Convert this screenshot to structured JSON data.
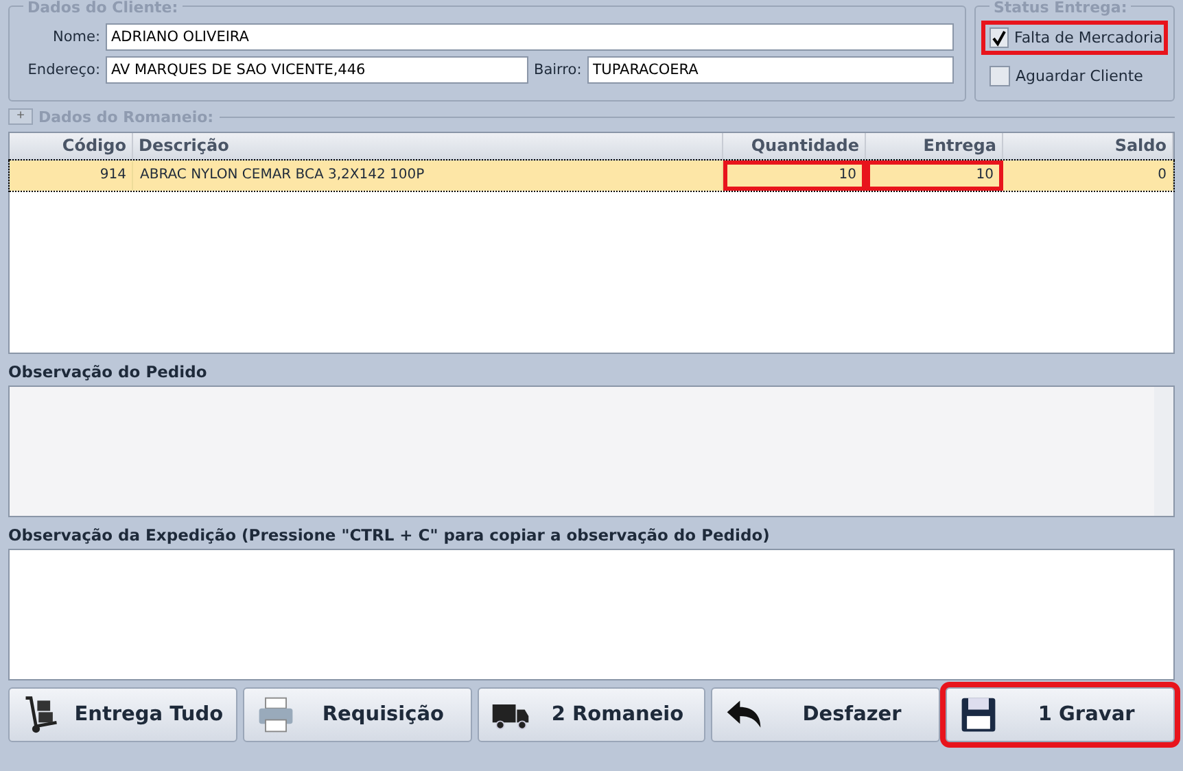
{
  "cliente": {
    "title": "Dados do Cliente:",
    "fields": [
      {
        "label": "Nome:",
        "value": "ADRIANO OLIVEIRA"
      },
      {
        "label": "Endereço:",
        "value": "AV MARQUES DE SAO VICENTE,446"
      },
      {
        "label": "Bairro:",
        "value": "TUPARACOERA"
      }
    ]
  },
  "status": {
    "title": "Status Entrega:",
    "options": [
      {
        "label": "Falta de Mercadoria",
        "checked": true,
        "highlighted": true
      },
      {
        "label": "Aguardar Cliente",
        "checked": false,
        "highlighted": false
      }
    ]
  },
  "romaneio": {
    "toggle": "+",
    "title": "Dados do Romaneio:"
  },
  "table": {
    "columns": [
      "Código",
      "Descrição",
      "Quantidade",
      "Entrega",
      "Saldo"
    ],
    "rows": [
      {
        "selected": true,
        "cells": [
          "914",
          "ABRAC NYLON CEMAR BCA 3,2X142 100P",
          "10",
          "10",
          "0"
        ],
        "highlighted_cells": [
          false,
          false,
          true,
          true,
          false
        ]
      }
    ]
  },
  "obs_pedido": {
    "label": "Observação do Pedido"
  },
  "obs_expedicao": {
    "label": "Observação da Expedição (Pressione \"CTRL + C\" para copiar a observação do Pedido)"
  },
  "buttons": [
    {
      "kind": "dolly",
      "label": "Entrega Tudo",
      "highlighted": false
    },
    {
      "kind": "printer",
      "label": "Requisição",
      "highlighted": false
    },
    {
      "kind": "truck",
      "label": "2 Romaneio",
      "highlighted": false
    },
    {
      "kind": "undo",
      "label": "Desfazer",
      "highlighted": false
    },
    {
      "kind": "save",
      "label": "1 Gravar",
      "highlighted": true
    }
  ]
}
